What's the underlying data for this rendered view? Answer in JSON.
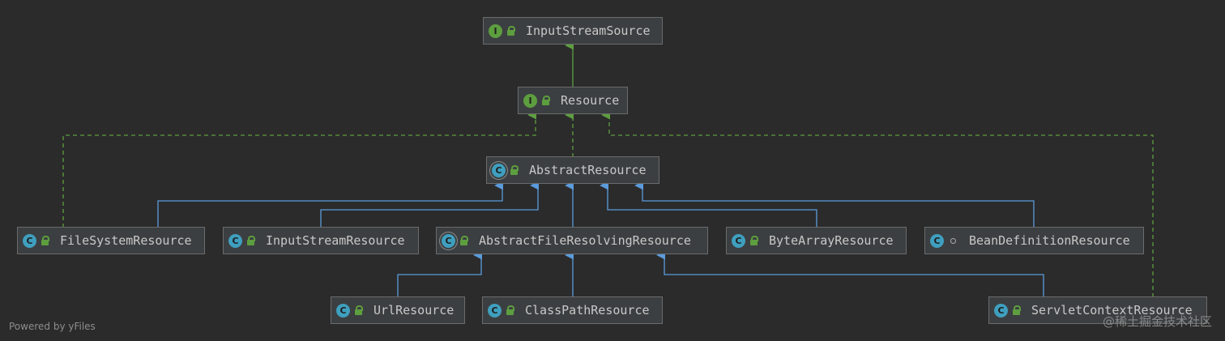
{
  "nodes": [
    {
      "id": "inputstreamsource",
      "label": "InputStreamSource",
      "kind": "interface",
      "badge": "I"
    },
    {
      "id": "resource",
      "label": "Resource",
      "kind": "interface",
      "badge": "I"
    },
    {
      "id": "abstractresource",
      "label": "AbstractResource",
      "kind": "abstract-class",
      "badge": "C"
    },
    {
      "id": "filesystemresource",
      "label": "FileSystemResource",
      "kind": "class",
      "badge": "C"
    },
    {
      "id": "inputstreamresource",
      "label": "InputStreamResource",
      "kind": "class",
      "badge": "C"
    },
    {
      "id": "abstractfileresolvingresource",
      "label": "AbstractFileResolvingResource",
      "kind": "abstract-class",
      "badge": "C"
    },
    {
      "id": "bytearrayresource",
      "label": "ByteArrayResource",
      "kind": "class",
      "badge": "C"
    },
    {
      "id": "beandefinitionresource",
      "label": "BeanDefinitionResource",
      "kind": "class",
      "badge": "C",
      "visibility": "package"
    },
    {
      "id": "urlresource",
      "label": "UrlResource",
      "kind": "class",
      "badge": "C"
    },
    {
      "id": "classpathresource",
      "label": "ClassPathResource",
      "kind": "class",
      "badge": "C"
    },
    {
      "id": "servletcontextresource",
      "label": "ServletContextResource",
      "kind": "class",
      "badge": "C"
    }
  ],
  "edges": [
    {
      "from": "resource",
      "to": "inputstreamsource",
      "type": "extends-interface"
    },
    {
      "from": "abstractresource",
      "to": "resource",
      "type": "implements"
    },
    {
      "from": "filesystemresource",
      "to": "resource",
      "type": "implements"
    },
    {
      "from": "servletcontextresource",
      "to": "resource",
      "type": "implements"
    },
    {
      "from": "filesystemresource",
      "to": "abstractresource",
      "type": "extends"
    },
    {
      "from": "inputstreamresource",
      "to": "abstractresource",
      "type": "extends"
    },
    {
      "from": "abstractfileresolvingresource",
      "to": "abstractresource",
      "type": "extends"
    },
    {
      "from": "bytearrayresource",
      "to": "abstractresource",
      "type": "extends"
    },
    {
      "from": "beandefinitionresource",
      "to": "abstractresource",
      "type": "extends"
    },
    {
      "from": "urlresource",
      "to": "abstractfileresolvingresource",
      "type": "extends"
    },
    {
      "from": "classpathresource",
      "to": "abstractfileresolvingresource",
      "type": "extends"
    },
    {
      "from": "servletcontextresource",
      "to": "abstractfileresolvingresource",
      "type": "extends"
    }
  ],
  "colors": {
    "background": "#2b2b2b",
    "extends_edge": "#5a9bdc",
    "implements_edge": "#5d9e3f",
    "interface_badge": "#5d9e3f",
    "class_badge": "#3f9fbf"
  },
  "footer": {
    "powered_by": "Powered by yFiles"
  },
  "watermark": {
    "text": "@稀土掘金技术社区"
  }
}
